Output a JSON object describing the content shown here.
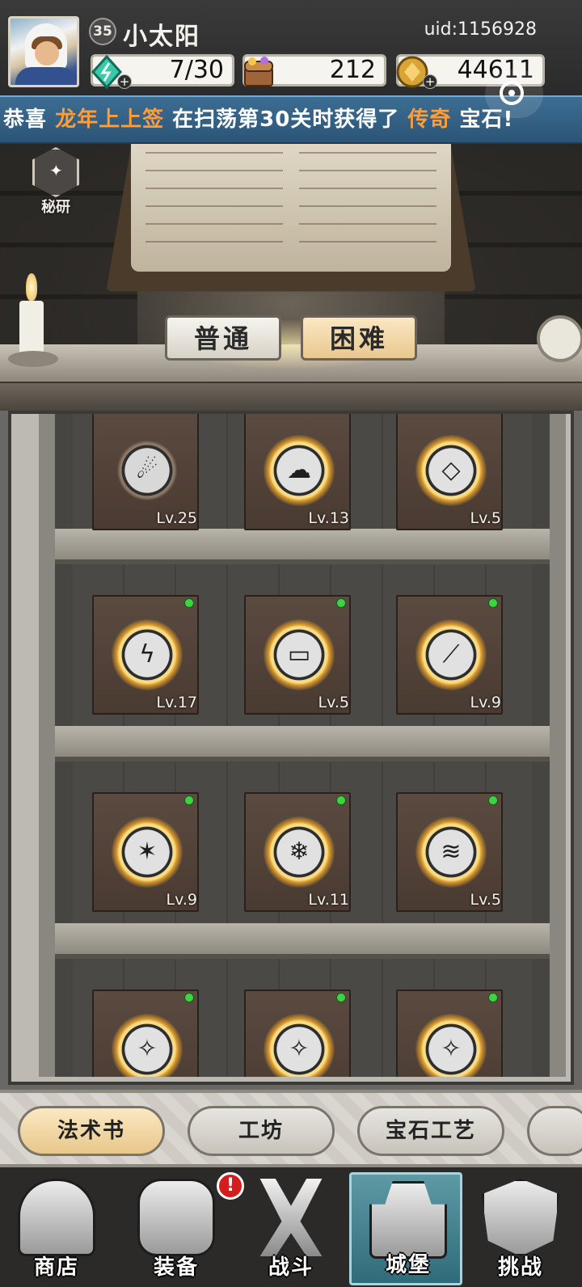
{
  "player": {
    "level": "35",
    "name": "小太阳",
    "uid": "uid:1156928"
  },
  "resources": {
    "energy": "7/30",
    "chests": "212",
    "coins": "44611"
  },
  "news": {
    "prefix": "恭喜 ",
    "player": "龙年上上签",
    "middle": " 在扫荡第30关时获得了 ",
    "rarity": "传奇",
    "suffix": " 宝石!"
  },
  "research": {
    "label": "秘研"
  },
  "modes": {
    "normal": "普通",
    "hard": "困难",
    "selected": "hard"
  },
  "spellbooks": [
    {
      "level": "Lv.25",
      "icon": "droplets-icon",
      "unlocked": false,
      "has_dot": false
    },
    {
      "level": "Lv.13",
      "icon": "slime-icon",
      "unlocked": true,
      "has_dot": false
    },
    {
      "level": "Lv.5",
      "icon": "crystal-icon",
      "unlocked": true,
      "has_dot": false
    },
    {
      "level": "Lv.17",
      "icon": "lightning-icon",
      "unlocked": true,
      "has_dot": true
    },
    {
      "level": "Lv.5",
      "icon": "icicle-icon",
      "unlocked": true,
      "has_dot": true
    },
    {
      "level": "Lv.9",
      "icon": "blade-icon",
      "unlocked": true,
      "has_dot": true
    },
    {
      "level": "Lv.9",
      "icon": "meteor-icon",
      "unlocked": true,
      "has_dot": true
    },
    {
      "level": "Lv.11",
      "icon": "ice-shard-icon",
      "unlocked": true,
      "has_dot": true
    },
    {
      "level": "Lv.5",
      "icon": "chain-lightning-icon",
      "unlocked": true,
      "has_dot": true
    },
    {
      "level": "",
      "icon": "spell-icon",
      "unlocked": true,
      "has_dot": true
    },
    {
      "level": "",
      "icon": "spell-icon",
      "unlocked": true,
      "has_dot": true
    },
    {
      "level": "",
      "icon": "spell-icon",
      "unlocked": true,
      "has_dot": true
    }
  ],
  "tabs": [
    {
      "label": "法术书",
      "active": true
    },
    {
      "label": "工坊",
      "active": false
    },
    {
      "label": "宝石工艺",
      "active": false
    },
    {
      "label": "",
      "active": false
    }
  ],
  "nav": {
    "shop": "商店",
    "equipment": "装备",
    "battle": "战斗",
    "castle": "城堡",
    "challenge": "挑战",
    "equipment_alert": "!"
  },
  "colors": {
    "highlight": "#ff9d3a",
    "active_tab": "#f5d9a5",
    "dot_green": "#3ed343"
  }
}
